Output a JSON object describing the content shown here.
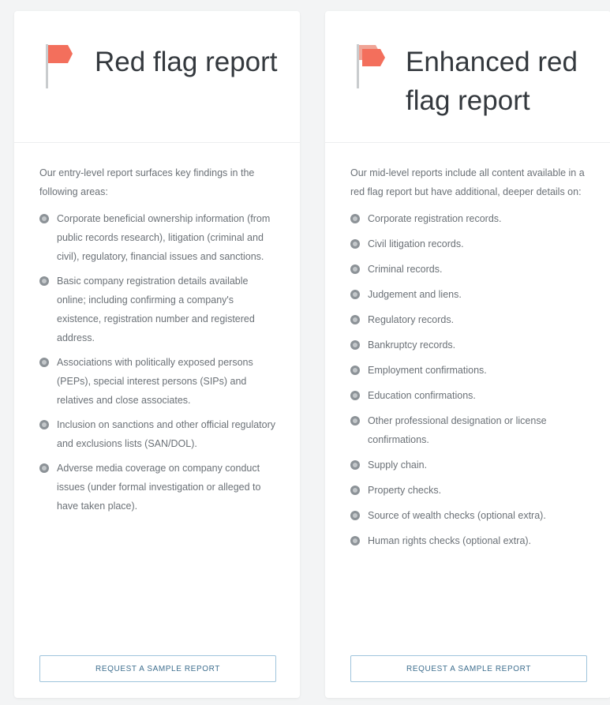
{
  "colors": {
    "flag_red": "#f36f5c",
    "button_border": "#9fc4dc",
    "button_text": "#3f6f8f"
  },
  "cards": [
    {
      "icon": "red-flag-icon",
      "title": "Red flag report",
      "intro": "Our entry-level report surfaces key findings in the following areas:",
      "items": [
        "Corporate beneficial ownership information (from public records research), litigation (criminal and civil), regulatory, financial issues and sanctions.",
        "Basic company registration details available online; including confirming a company's existence, registration number and registered address.",
        "Associations with politically exposed persons (PEPs), special interest persons (SIPs) and relatives and close associates.",
        "Inclusion on sanctions and other official regulatory and exclusions lists (SAN/DOL).",
        "Adverse media coverage on company conduct issues (under formal investigation or alleged to have taken place)."
      ],
      "button_label": "Request a sample report"
    },
    {
      "icon": "double-red-flag-icon",
      "title": "Enhanced red flag report",
      "intro": "Our mid-level reports include all content available in a red flag report but have additional, deeper details on:",
      "items": [
        "Corporate registration records.",
        "Civil litigation records.",
        "Criminal records.",
        "Judgement and liens.",
        "Regulatory records.",
        "Bankruptcy records.",
        "Employment confirmations.",
        "Education confirmations.",
        "Other professional designation or license confirmations.",
        "Supply chain.",
        "Property checks.",
        "Source of wealth checks (optional extra).",
        "Human rights checks (optional extra)."
      ],
      "button_label": "Request a sample report"
    }
  ]
}
